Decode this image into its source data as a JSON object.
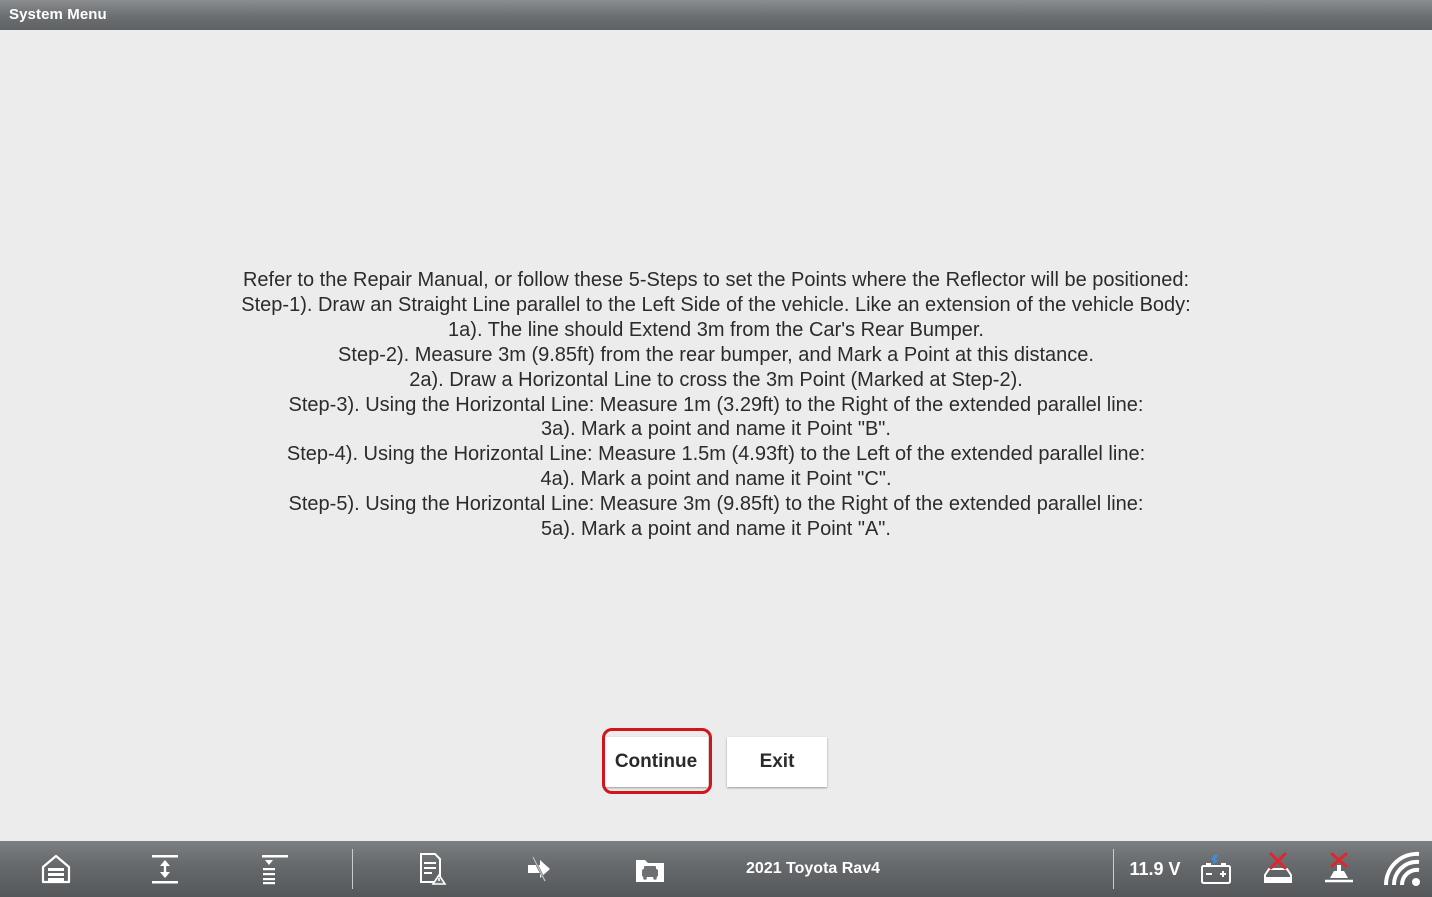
{
  "titlebar": {
    "title": "System Menu"
  },
  "instructions": {
    "lines": [
      "Refer to the Repair Manual, or follow these 5-Steps to set the Points where the Reflector will be positioned:",
      "Step-1). Draw an Straight Line parallel to the Left Side of the vehicle. Like an extension of the vehicle Body:",
      "1a). The line should Extend 3m from the Car's Rear Bumper.",
      "Step-2). Measure 3m (9.85ft) from the rear bumper, and Mark a Point at this distance.",
      "2a). Draw a Horizontal Line to cross the 3m Point (Marked at Step-2).",
      "Step-3). Using the Horizontal Line: Measure 1m (3.29ft) to the Right of the extended parallel line:",
      "3a). Mark a point and name it Point \"B\".",
      "Step-4). Using the Horizontal Line: Measure 1.5m (4.93ft) to the Left of the extended parallel line:",
      "4a). Mark a point and name it Point \"C\".",
      "Step-5). Using the Horizontal Line: Measure 3m (9.85ft) to the Right of the extended parallel line:",
      "5a). Mark a point and name it Point \"A\"."
    ]
  },
  "buttons": {
    "continue_label": "Continue",
    "exit_label": "Exit"
  },
  "taskbar": {
    "vehicle": "2021 Toyota Rav4",
    "voltage": "11.9 V",
    "icons": [
      "home-garage-icon",
      "expand-all-icon",
      "collapse-list-icon",
      "report-icon",
      "shortcut-arrow-icon",
      "vehicle-folder-icon",
      "battery-icon",
      "vci-disconnected-icon",
      "vehicle-disconnected-icon",
      "wifi-icon"
    ]
  },
  "colors": {
    "background": "#ececec",
    "bar": "#6e7174",
    "highlight": "#d2141c",
    "text": "#2b2b2b"
  }
}
